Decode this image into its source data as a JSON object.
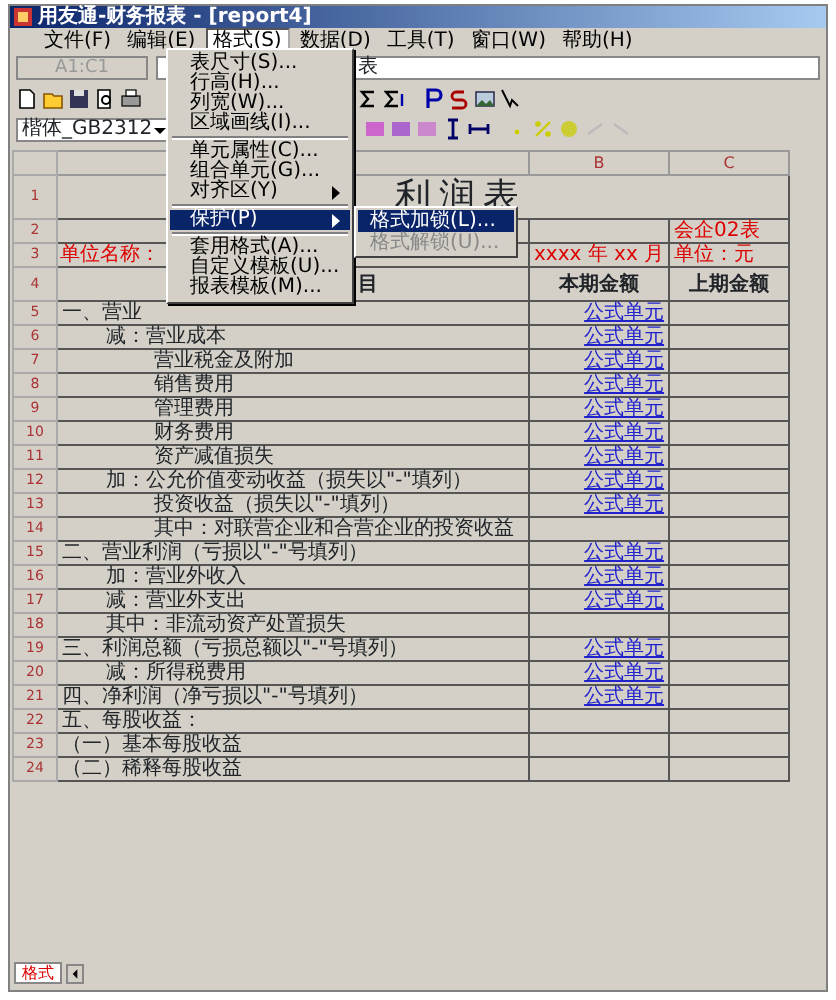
{
  "window": {
    "title": "用友通-财务报表 - [report4]"
  },
  "menu_bar": [
    {
      "label": "文件(F)",
      "selected": false
    },
    {
      "label": "编辑(E)",
      "selected": false
    },
    {
      "label": "格式(S)",
      "selected": true
    },
    {
      "label": "数据(D)",
      "selected": false
    },
    {
      "label": "工具(T)",
      "selected": false
    },
    {
      "label": "窗口(W)",
      "selected": false
    },
    {
      "label": "帮助(H)",
      "selected": false
    }
  ],
  "cell_reference": "A1:C1",
  "formula": "表",
  "font_selector": "楷体_GB2312",
  "format_menu": {
    "items": [
      {
        "kind": "item",
        "label": "表尺寸(S)...",
        "selected": false
      },
      {
        "kind": "item",
        "label": "行高(H)...",
        "selected": false
      },
      {
        "kind": "item",
        "label": "列宽(W)...",
        "selected": false
      },
      {
        "kind": "item",
        "label": "区域画线(I)...",
        "selected": false
      },
      {
        "kind": "separator"
      },
      {
        "kind": "item",
        "label": "单元属性(C)...",
        "selected": false
      },
      {
        "kind": "item",
        "label": "组合单元(G)...",
        "selected": false
      },
      {
        "kind": "submenu",
        "label": "对齐区(Y)",
        "selected": false
      },
      {
        "kind": "separator"
      },
      {
        "kind": "submenu",
        "label": "保护(P)",
        "selected": true
      },
      {
        "kind": "separator"
      },
      {
        "kind": "item",
        "label": "套用格式(A)...",
        "selected": false
      },
      {
        "kind": "item",
        "label": "自定义模板(U)...",
        "selected": false
      },
      {
        "kind": "item",
        "label": "报表模板(M)...",
        "selected": false
      }
    ],
    "submenu": [
      {
        "label": "格式加锁(L)...",
        "selected": true,
        "disabled": false
      },
      {
        "label": "格式解锁(U)...",
        "selected": false,
        "disabled": true
      }
    ]
  },
  "sheet": {
    "columns": [
      "B",
      "C"
    ],
    "rows": [
      {
        "number": "1",
        "kind": "title",
        "a": "利润表"
      },
      {
        "number": "2",
        "kind": "note",
        "c": "会企02表"
      },
      {
        "number": "3",
        "kind": "note",
        "a": "单位名称：",
        "b": "xxxx 年 xx 月",
        "c": "单位：元"
      },
      {
        "number": "4",
        "kind": "header",
        "a": "目",
        "b": "本期金额",
        "c": "上期金额"
      },
      {
        "number": "5",
        "kind": "top",
        "a": "一、营业",
        "b": "公式单元"
      },
      {
        "number": "6",
        "kind": "sub",
        "a": "减：营业成本",
        "b": "公式单元"
      },
      {
        "number": "7",
        "kind": "detail",
        "a": "营业税金及附加",
        "b": "公式单元"
      },
      {
        "number": "8",
        "kind": "detail",
        "a": "销售费用",
        "b": "公式单元"
      },
      {
        "number": "9",
        "kind": "detail",
        "a": "管理费用",
        "b": "公式单元"
      },
      {
        "number": "10",
        "kind": "detail",
        "a": "财务费用",
        "b": "公式单元"
      },
      {
        "number": "11",
        "kind": "detail",
        "a": "资产减值损失",
        "b": "公式单元"
      },
      {
        "number": "12",
        "kind": "sub",
        "a": "加：公允价值变动收益（损失以\"-\"填列）",
        "b": "公式单元"
      },
      {
        "number": "13",
        "kind": "detail",
        "a": "投资收益（损失以\"-\"填列）",
        "b": "公式单元"
      },
      {
        "number": "14",
        "kind": "detail",
        "a": "其中：对联营企业和合营企业的投资收益"
      },
      {
        "number": "15",
        "kind": "top",
        "a": "二、营业利润（亏损以\"-\"号填列）",
        "b": "公式单元"
      },
      {
        "number": "16",
        "kind": "sub",
        "a": "加：营业外收入",
        "b": "公式单元"
      },
      {
        "number": "17",
        "kind": "sub",
        "a": "减：营业外支出",
        "b": "公式单元"
      },
      {
        "number": "18",
        "kind": "sub",
        "a": "其中：非流动资产处置损失"
      },
      {
        "number": "19",
        "kind": "top",
        "a": "三、利润总额（亏损总额以\"-\"号填列）",
        "b": "公式单元"
      },
      {
        "number": "20",
        "kind": "sub",
        "a": "减：所得税费用",
        "b": "公式单元"
      },
      {
        "number": "21",
        "kind": "top",
        "a": "四、净利润（净亏损以\"-\"号填列）",
        "b": "公式单元"
      },
      {
        "number": "22",
        "kind": "top",
        "a": "五、每股收益："
      },
      {
        "number": "23",
        "kind": "top",
        "a": "（一）基本每股收益"
      },
      {
        "number": "24",
        "kind": "top",
        "a": "（二）稀释每股收益"
      }
    ]
  },
  "sheet_tab": "格式"
}
